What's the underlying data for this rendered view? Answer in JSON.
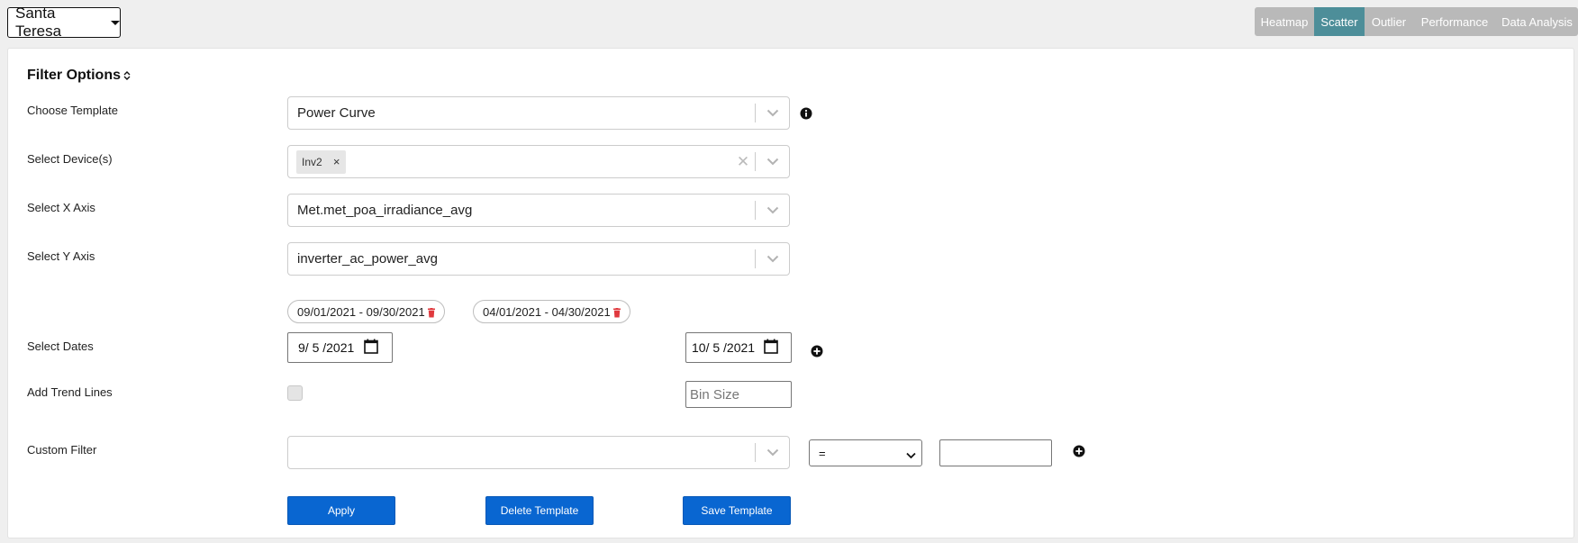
{
  "header": {
    "site_selector": "Santa Teresa",
    "tabs": [
      {
        "label": "Heatmap",
        "active": false
      },
      {
        "label": "Scatter",
        "active": true
      },
      {
        "label": "Outlier",
        "active": false
      },
      {
        "label": "Performance",
        "active": false
      },
      {
        "label": "Data Analysis",
        "active": false
      }
    ]
  },
  "filter": {
    "title": "Filter Options",
    "template": {
      "label": "Choose Template",
      "value": "Power Curve"
    },
    "devices": {
      "label": "Select Device(s)",
      "chips": [
        "Inv2"
      ]
    },
    "x_axis": {
      "label": "Select X Axis",
      "value": "Met.met_poa_irradiance_avg"
    },
    "y_axis": {
      "label": "Select Y Axis",
      "value": "inverter_ac_power_avg"
    },
    "date_ranges": [
      "09/01/2021 - 09/30/2021",
      "04/01/2021 - 04/30/2021"
    ],
    "dates": {
      "label": "Select Dates",
      "start": "9/ 5 /2021",
      "end": "10/ 5 /2021"
    },
    "trend": {
      "label": "Add Trend Lines",
      "checked": false,
      "bin_placeholder": "Bin Size"
    },
    "custom": {
      "label": "Custom Filter",
      "field_value": "",
      "operator": "=",
      "value": ""
    },
    "buttons": {
      "apply": "Apply",
      "delete": "Delete Template",
      "save": "Save Template"
    }
  },
  "colors": {
    "accent": "#0966d1",
    "tab_active": "#4d8e99",
    "tab_inactive": "#b9b9b9",
    "trash": "#e0393e"
  }
}
